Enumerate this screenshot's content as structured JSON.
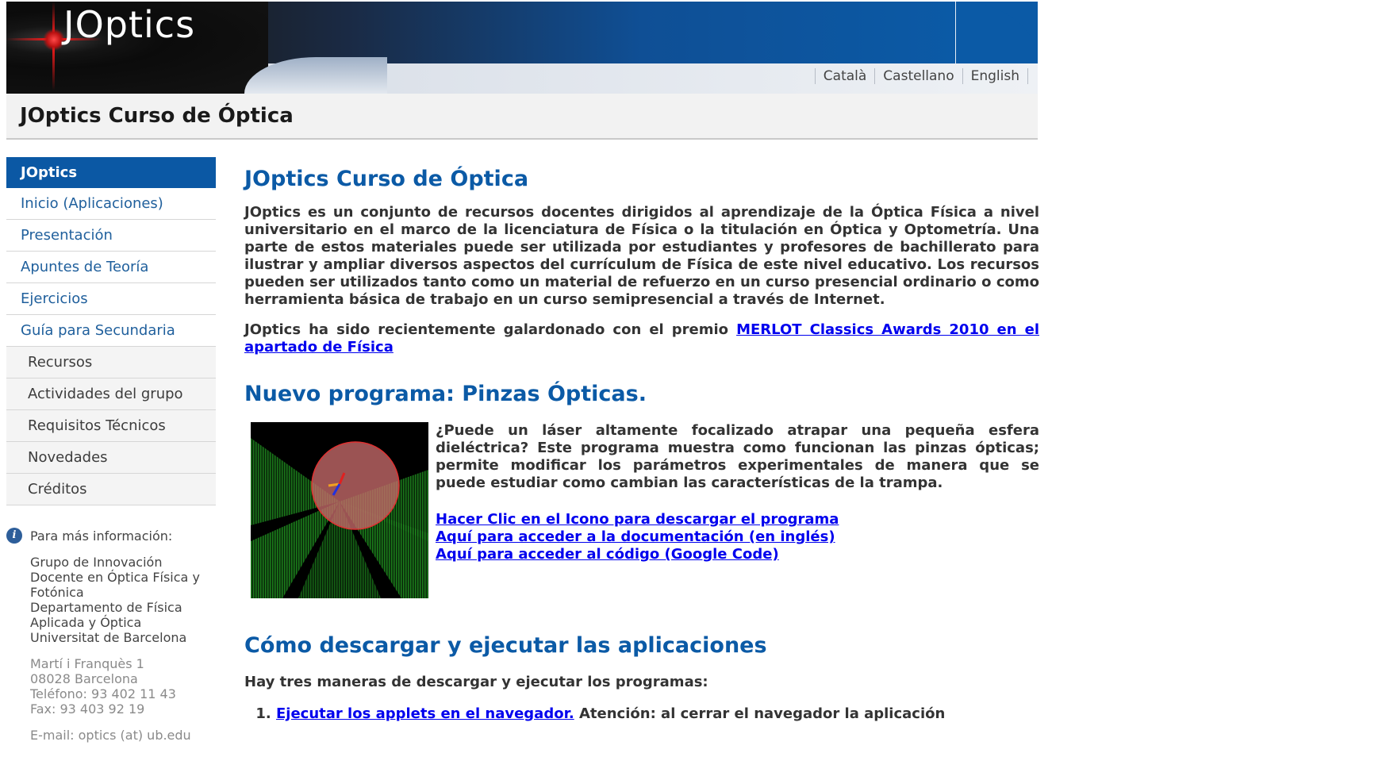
{
  "header": {
    "logo_text": "JOptics",
    "languages": [
      "Català",
      "Castellano",
      "English"
    ],
    "title": "JOptics Curso de Óptica"
  },
  "sidebar": {
    "heading": "JOptics",
    "items": [
      {
        "label": "Inicio (Aplicaciones)"
      },
      {
        "label": "Presentación"
      },
      {
        "label": "Apuntes de Teoría"
      },
      {
        "label": "Ejercicios"
      },
      {
        "label": "Guía para Secundaria"
      }
    ],
    "subitems": [
      {
        "label": "Recursos"
      },
      {
        "label": "Actividades del grupo"
      },
      {
        "label": "Requisitos Técnicos"
      },
      {
        "label": "Novedades"
      },
      {
        "label": "Créditos"
      }
    ],
    "info": {
      "heading": "Para más información:",
      "org_lines": [
        "Grupo de Innovación",
        "Docente en Óptica Física y",
        "Fotónica",
        "Departamento de Física",
        "Aplicada y Óptica",
        "Universitat de Barcelona"
      ],
      "address_lines": [
        "Martí i Franquès 1",
        "08028 Barcelona",
        "Teléfono: 93 402 11 43",
        "Fax: 93 403 92 19"
      ],
      "email": "E-mail: optics (at) ub.edu"
    }
  },
  "main": {
    "section1": {
      "title": "JOptics Curso de Óptica",
      "para1": "JOptics es un conjunto de recursos docentes dirigidos al aprendizaje de la Óptica Física a nivel universitario en el marco de la licenciatura de Física o la titulación en Óptica y Optometría. Una parte de estos materiales puede ser utilizada por estudiantes y profesores de bachillerato para ilustrar y ampliar diversos aspectos del currículum de Física de este nivel educativo. Los recursos pueden ser utilizados tanto como un material de refuerzo en un curso presencial ordinario o como herramienta básica de trabajo en un curso semipresencial a través de Internet.",
      "para2_prefix": "JOptics ha sido recientemente galardonado con el premio",
      "para2_link": "MERLOT Classics Awards 2010 en el apartado de Física"
    },
    "section2": {
      "title": "Nuevo programa: Pinzas Ópticas.",
      "description": "¿Puede un láser altamente focalizado atrapar una pequeña esfera dieléctrica?  Este programa muestra como funcionan las pinzas ópticas;  permite modificar los parámetros experimentales de manera que se puede estudiar como cambian las características de la trampa.",
      "links": [
        "Hacer Clic en el Icono para descargar el programa",
        "Aquí para acceder a la documentación (en inglés)",
        "Aquí para acceder al código (Google Code)"
      ]
    },
    "section3": {
      "title": "Cómo descargar y ejecutar las aplicaciones",
      "intro": "Hay tres maneras de descargar y ejecutar los programas:",
      "item1_link": "Ejecutar los applets en el navegador.",
      "item1_text": "Atención: al cerrar el navegador la aplicación"
    }
  },
  "colors": {
    "brand_blue": "#0b5aa6",
    "link": "#0000ee",
    "nav_text": "#1f5f9c"
  }
}
